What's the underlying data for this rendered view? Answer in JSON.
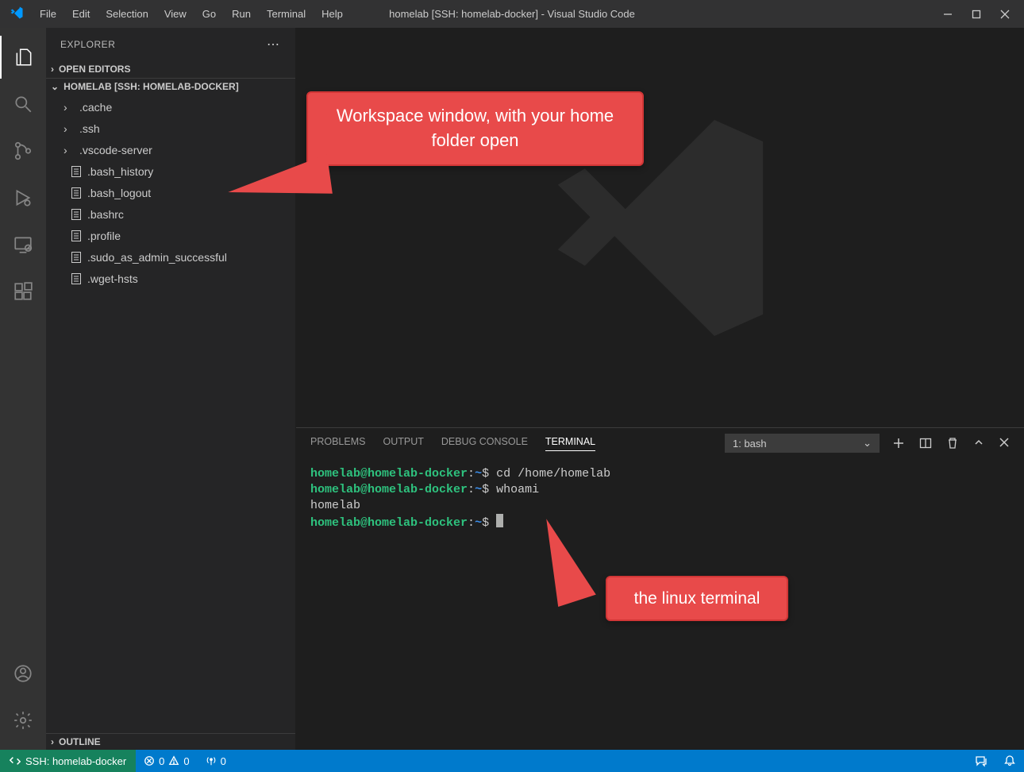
{
  "title": "homelab [SSH: homelab-docker] - Visual Studio Code",
  "menu": [
    "File",
    "Edit",
    "Selection",
    "View",
    "Go",
    "Run",
    "Terminal",
    "Help"
  ],
  "explorer": {
    "title": "EXPLORER",
    "openEditors": "OPEN EDITORS",
    "workspaceLabel": "HOMELAB [SSH: HOMELAB-DOCKER]",
    "outline": "OUTLINE",
    "tree": [
      {
        "type": "folder",
        "name": ".cache"
      },
      {
        "type": "folder",
        "name": ".ssh"
      },
      {
        "type": "folder",
        "name": ".vscode-server"
      },
      {
        "type": "file",
        "name": ".bash_history"
      },
      {
        "type": "file",
        "name": ".bash_logout"
      },
      {
        "type": "file",
        "name": ".bashrc"
      },
      {
        "type": "file",
        "name": ".profile"
      },
      {
        "type": "file",
        "name": ".sudo_as_admin_successful"
      },
      {
        "type": "file",
        "name": ".wget-hsts"
      }
    ]
  },
  "panel": {
    "tabs": [
      "PROBLEMS",
      "OUTPUT",
      "DEBUG CONSOLE",
      "TERMINAL"
    ],
    "activeTab": "TERMINAL",
    "terminalSelect": "1: bash"
  },
  "terminal": {
    "promptUser": "homelab@homelab-docker",
    "promptPath": "~",
    "lines": [
      {
        "prompt": true,
        "cmd": "cd /home/homelab"
      },
      {
        "prompt": true,
        "cmd": "whoami"
      },
      {
        "output": "homelab"
      },
      {
        "prompt": true,
        "cmd": ""
      }
    ]
  },
  "status": {
    "remote": "SSH: homelab-docker",
    "errors": "0",
    "warnings": "0",
    "ports": "0"
  },
  "callouts": {
    "c1": "Workspace window, with your home folder open",
    "c2": "the linux terminal"
  }
}
